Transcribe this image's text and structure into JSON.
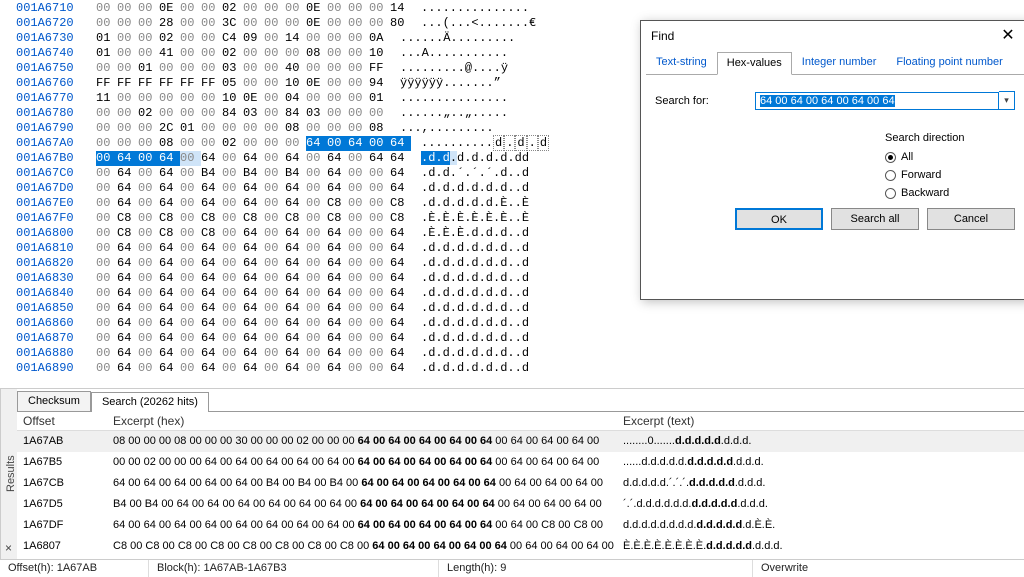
{
  "hex_rows": [
    {
      "addr": "001A6710",
      "bytes": [
        "00",
        "00",
        "00",
        "0E",
        "00",
        "00",
        "02",
        "00",
        "00",
        "00",
        "0E",
        "00",
        "00",
        "00",
        "14"
      ],
      "ascii": "..............."
    },
    {
      "addr": "001A6720",
      "bytes": [
        "00",
        "00",
        "00",
        "28",
        "00",
        "00",
        "3C",
        "00",
        "00",
        "00",
        "0E",
        "00",
        "00",
        "00",
        "80"
      ],
      "ascii": "...(...<.......€"
    },
    {
      "addr": "001A6730",
      "bytes": [
        "01",
        "00",
        "00",
        "02",
        "00",
        "00",
        "C4",
        "09",
        "00",
        "14",
        "00",
        "00",
        "00",
        "0A"
      ],
      "ascii": "......Ä........."
    },
    {
      "addr": "001A6740",
      "bytes": [
        "01",
        "00",
        "00",
        "41",
        "00",
        "00",
        "02",
        "00",
        "00",
        "00",
        "08",
        "00",
        "00",
        "10"
      ],
      "ascii": "...A..........."
    },
    {
      "addr": "001A6750",
      "bytes": [
        "00",
        "00",
        "01",
        "00",
        "00",
        "00",
        "03",
        "00",
        "00",
        "40",
        "00",
        "00",
        "00",
        "FF"
      ],
      "ascii": ".........@....ÿ"
    },
    {
      "addr": "001A6760",
      "bytes": [
        "FF",
        "FF",
        "FF",
        "FF",
        "FF",
        "FF",
        "05",
        "00",
        "00",
        "10",
        "0E",
        "00",
        "00",
        "94"
      ],
      "ascii": "ÿÿÿÿÿÿ.......”"
    },
    {
      "addr": "001A6770",
      "bytes": [
        "11",
        "00",
        "00",
        "00",
        "00",
        "00",
        "10",
        "0E",
        "00",
        "04",
        "00",
        "00",
        "00",
        "01"
      ],
      "ascii": "..............."
    },
    {
      "addr": "001A6780",
      "bytes": [
        "00",
        "00",
        "02",
        "00",
        "00",
        "00",
        "84",
        "03",
        "00",
        "84",
        "03",
        "00",
        "00",
        "00"
      ],
      "ascii": "......„..„....."
    },
    {
      "addr": "001A6790",
      "bytes": [
        "00",
        "00",
        "00",
        "2C",
        "01",
        "00",
        "00",
        "00",
        "00",
        "08",
        "00",
        "00",
        "00",
        "08"
      ],
      "ascii": "...,........."
    },
    {
      "addr": "001A67A0",
      "bytes": [
        "00",
        "00",
        "00",
        "08",
        "00",
        "00",
        "02",
        "00",
        "00",
        "00",
        "64",
        "00",
        "64",
        "00",
        "64"
      ],
      "hl": [
        10,
        11,
        12,
        13,
        14
      ],
      "ascii": "..........d.d.d",
      "ascii_box": [
        10,
        14
      ]
    },
    {
      "addr": "001A67B0",
      "bytes": [
        "00",
        "64",
        "00",
        "64",
        "00",
        "64",
        "00",
        "64",
        "00",
        "64",
        "00",
        "64",
        "00",
        "64",
        "64"
      ],
      "hl": [
        0,
        1,
        2,
        3
      ],
      "hl2": [
        4
      ],
      "ascii": ".d.d.d.d.d.d.dd",
      "ascii_hl": [
        0,
        1,
        2,
        3
      ],
      "ascii_hl2": [
        4
      ]
    },
    {
      "addr": "001A67C0",
      "bytes": [
        "00",
        "64",
        "00",
        "64",
        "00",
        "B4",
        "00",
        "B4",
        "00",
        "B4",
        "00",
        "64",
        "00",
        "00",
        "64"
      ],
      "ascii": ".d.d.´.´.´.d..d"
    },
    {
      "addr": "001A67D0",
      "bytes": [
        "00",
        "64",
        "00",
        "64",
        "00",
        "64",
        "00",
        "64",
        "00",
        "64",
        "00",
        "64",
        "00",
        "00",
        "64"
      ],
      "ascii": ".d.d.d.d.d.d..d"
    },
    {
      "addr": "001A67E0",
      "bytes": [
        "00",
        "64",
        "00",
        "64",
        "00",
        "64",
        "00",
        "64",
        "00",
        "64",
        "00",
        "C8",
        "00",
        "00",
        "C8"
      ],
      "ascii": ".d.d.d.d.d.È..È"
    },
    {
      "addr": "001A67F0",
      "bytes": [
        "00",
        "C8",
        "00",
        "C8",
        "00",
        "C8",
        "00",
        "C8",
        "00",
        "C8",
        "00",
        "C8",
        "00",
        "00",
        "C8"
      ],
      "ascii": ".È.È.È.È.È.È..È"
    },
    {
      "addr": "001A6800",
      "bytes": [
        "00",
        "C8",
        "00",
        "C8",
        "00",
        "C8",
        "00",
        "64",
        "00",
        "64",
        "00",
        "64",
        "00",
        "00",
        "64"
      ],
      "ascii": ".È.È.È.d.d.d..d"
    },
    {
      "addr": "001A6810",
      "bytes": [
        "00",
        "64",
        "00",
        "64",
        "00",
        "64",
        "00",
        "64",
        "00",
        "64",
        "00",
        "64",
        "00",
        "00",
        "64"
      ],
      "ascii": ".d.d.d.d.d.d..d"
    },
    {
      "addr": "001A6820",
      "bytes": [
        "00",
        "64",
        "00",
        "64",
        "00",
        "64",
        "00",
        "64",
        "00",
        "64",
        "00",
        "64",
        "00",
        "00",
        "64"
      ],
      "ascii": ".d.d.d.d.d.d..d"
    },
    {
      "addr": "001A6830",
      "bytes": [
        "00",
        "64",
        "00",
        "64",
        "00",
        "64",
        "00",
        "64",
        "00",
        "64",
        "00",
        "64",
        "00",
        "00",
        "64"
      ],
      "ascii": ".d.d.d.d.d.d..d"
    },
    {
      "addr": "001A6840",
      "bytes": [
        "00",
        "64",
        "00",
        "64",
        "00",
        "64",
        "00",
        "64",
        "00",
        "64",
        "00",
        "64",
        "00",
        "00",
        "64"
      ],
      "ascii": ".d.d.d.d.d.d..d"
    },
    {
      "addr": "001A6850",
      "bytes": [
        "00",
        "64",
        "00",
        "64",
        "00",
        "64",
        "00",
        "64",
        "00",
        "64",
        "00",
        "64",
        "00",
        "00",
        "64"
      ],
      "ascii": ".d.d.d.d.d.d..d"
    },
    {
      "addr": "001A6860",
      "bytes": [
        "00",
        "64",
        "00",
        "64",
        "00",
        "64",
        "00",
        "64",
        "00",
        "64",
        "00",
        "64",
        "00",
        "00",
        "64"
      ],
      "ascii": ".d.d.d.d.d.d..d"
    },
    {
      "addr": "001A6870",
      "bytes": [
        "00",
        "64",
        "00",
        "64",
        "00",
        "64",
        "00",
        "64",
        "00",
        "64",
        "00",
        "64",
        "00",
        "00",
        "64"
      ],
      "ascii": ".d.d.d.d.d.d..d"
    },
    {
      "addr": "001A6880",
      "bytes": [
        "00",
        "64",
        "00",
        "64",
        "00",
        "64",
        "00",
        "64",
        "00",
        "64",
        "00",
        "64",
        "00",
        "00",
        "64"
      ],
      "ascii": ".d.d.d.d.d.d..d"
    },
    {
      "addr": "001A6890",
      "bytes": [
        "00",
        "64",
        "00",
        "64",
        "00",
        "64",
        "00",
        "64",
        "00",
        "64",
        "00",
        "64",
        "00",
        "00",
        "64"
      ],
      "ascii": ".d.d.d.d.d.d..d"
    }
  ],
  "results": {
    "side_label": "Results",
    "tabs": [
      "Checksum",
      "Search (20262 hits)"
    ],
    "active_tab": 1,
    "columns": [
      "Offset",
      "Excerpt (hex)",
      "Excerpt (text)"
    ],
    "rows": [
      {
        "off": "1A67AB",
        "hex": "08 00 00 00 08 00 00 00 30 00 00 00 02 00 00 00 <b>64 00 64 00 64 00 64 00 64</b> 00 64 00 64 00 64 00",
        "txt": "........0.......<b>d.d.d.d.d</b>.d.d.d.",
        "sel": true
      },
      {
        "off": "1A67B5",
        "hex": "00 00 02 00 00 00 64 00 64 00 64 00 64 00 64 00 <b>64 00 64 00 64 00 64 00 64</b> 00 64 00 64 00 64 00",
        "txt": "......d.d.d.d.d.<b>d.d.d.d.d</b>.d.d.d.",
        "sel": false
      },
      {
        "off": "1A67CB",
        "hex": "64 00 64 00 64 00 64 00 64 00 B4 00 B4 00 B4 00 <b>64 00 64 00 64 00 64 00 64</b> 00 64 00 64 00 64 00",
        "txt": "d.d.d.d.d.´.´.´.<b>d.d.d.d.d</b>.d.d.d.",
        "sel": false
      },
      {
        "off": "1A67D5",
        "hex": "B4 00 B4 00 64 00 64 00 64 00 64 00 64 00 64 00 <b>64 00 64 00 64 00 64 00 64</b> 00 64 00 64 00 64 00",
        "txt": "´.´.d.d.d.d.d.d.<b>d.d.d.d.d</b>.d.d.d.",
        "sel": false
      },
      {
        "off": "1A67DF",
        "hex": "64 00 64 00 64 00 64 00 64 00 64 00 64 00 64 00 <b>64 00 64 00 64 00 64 00 64</b> 00 64 00 C8 00 C8 00",
        "txt": "d.d.d.d.d.d.d.d.<b>d.d.d.d.d</b>.d.È.È.",
        "sel": false
      },
      {
        "off": "1A6807",
        "hex": "C8 00 C8 00 C8 00 C8 00 C8 00 C8 00 C8 00 C8 00 <b>64 00 64 00 64 00 64 00 64</b> 00 64 00 64 00 64 00",
        "txt": "È.È.È.È.È.È.È.È.<b>d.d.d.d.d</b>.d.d.d.",
        "sel": false
      }
    ]
  },
  "status": {
    "offset": "Offset(h): 1A67AB",
    "block": "Block(h): 1A67AB-1A67B3",
    "length": "Length(h): 9",
    "mode": "Overwrite"
  },
  "find": {
    "title": "Find",
    "tabs": [
      "Text-string",
      "Hex-values",
      "Integer number",
      "Floating point number"
    ],
    "active_tab": 1,
    "search_label": "Search for:",
    "search_value": "64 00 64 00 64 00 64 00 64",
    "direction_label": "Search direction",
    "directions": [
      "All",
      "Forward",
      "Backward"
    ],
    "direction_selected": 0,
    "buttons": {
      "ok": "OK",
      "search_all": "Search all",
      "cancel": "Cancel"
    }
  }
}
